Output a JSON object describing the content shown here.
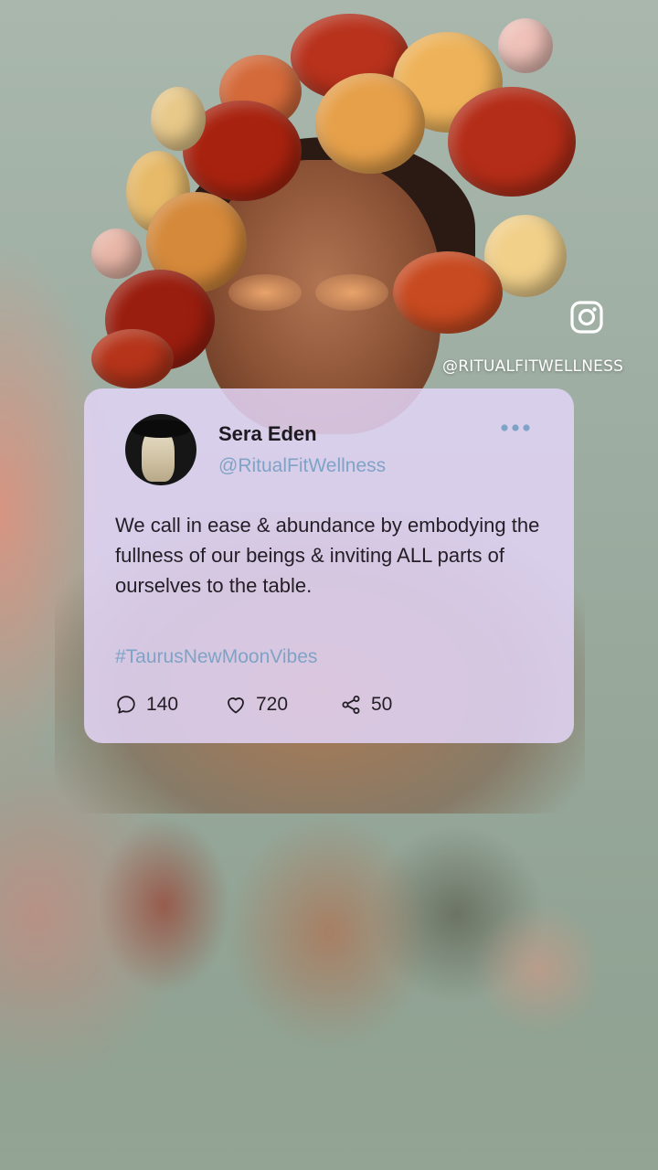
{
  "overlay": {
    "instagram_icon": "instagram-icon",
    "handle": "@RITUALFITWELLNESS"
  },
  "post": {
    "author_name": "Sera Eden",
    "author_handle": "@RitualFitWellness",
    "more_icon": "more-options-icon",
    "text": "We call in ease & abundance by embodying the fullness of our beings & inviting ALL parts of ourselves to the table.",
    "hashtag": "#TaurusNewMoonVibes",
    "stats": {
      "replies": "140",
      "likes": "720",
      "shares": "50"
    }
  },
  "colors": {
    "card_bg": "#e2d4f6",
    "accent_link": "#7fa3c6",
    "text": "#231e26"
  }
}
